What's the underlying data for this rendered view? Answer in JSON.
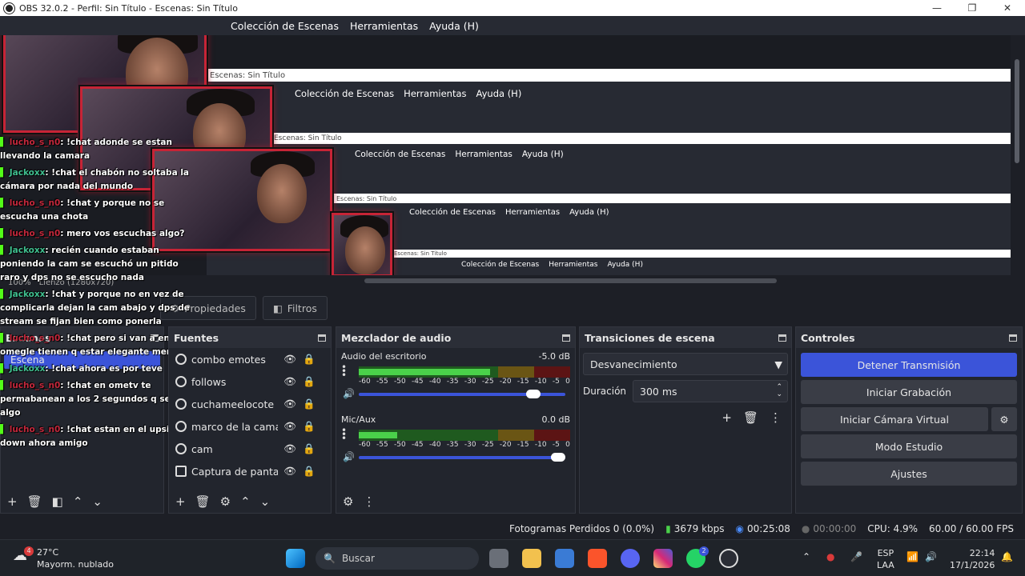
{
  "titlebar": {
    "title": "OBS 32.0.2 - Perfil: Sin Título - Escenas: Sin Título"
  },
  "menu": [
    "Colección de Escenas",
    "Herramientas",
    "Ayuda (H)"
  ],
  "nested": {
    "bar_label": "Escenas: Sin Título",
    "canvas_label": "Lienzo (1280x720)",
    "zoom": "100%"
  },
  "chat": [
    {
      "user": "lucho_s_n0",
      "text": ": !chat adonde se estan llevando la camara"
    },
    {
      "user": "Jackoxx",
      "text": ": !chat el chabón no soltaba la cámara por nada del mundo"
    },
    {
      "user": "lucho_s_n0",
      "text": ": !chat y porque no se escucha una chota"
    },
    {
      "user": "lucho_s_n0",
      "text": ": mero vos escuchas algo?"
    },
    {
      "user": "Jackoxx",
      "text": ": recién cuando estaban poniendo la cam se escuchó un pitido raro y dps no se escucho nada"
    },
    {
      "user": "Jackoxx",
      "text": ": !chat y porque no en vez de complicarla dejan la cam abajo y dps de stream se fijan bien como ponerla"
    },
    {
      "user": "lucho_s_n0",
      "text": ": !chat pero si van a entrar a omegle tienen q estar elegante mero"
    },
    {
      "user": "Jackoxx",
      "text": ": !chat ahora es por teve"
    },
    {
      "user": "lucho_s_n0",
      "text": ": !chat en ometv te permabanean a los 2 segundos q se ve algo"
    },
    {
      "user": "lucho_s_n0",
      "text": ": !chat estan en el upside down ahora amigo"
    }
  ],
  "tabs": {
    "properties": "Propiedades",
    "filters": "Filtros"
  },
  "scenes": {
    "title": "Escenas",
    "items": [
      "Escena"
    ]
  },
  "sources": {
    "title": "Fuentes",
    "items": [
      "combo emotes",
      "follows",
      "cuchameelocote",
      "marco de la camara",
      "cam",
      "Captura de pantalla"
    ]
  },
  "mixer": {
    "title": "Mezclador de audio",
    "channels": [
      {
        "name": "Audio del escritorio",
        "db": "-5.0 dB",
        "level": 0.62,
        "volume": 0.88
      },
      {
        "name": "Mic/Aux",
        "db": "0.0 dB",
        "level": 0.18,
        "volume": 1.0
      }
    ],
    "ticks": [
      "-60",
      "-55",
      "-50",
      "-45",
      "-40",
      "-35",
      "-30",
      "-25",
      "-20",
      "-15",
      "-10",
      "-5",
      "0"
    ]
  },
  "transitions": {
    "title": "Transiciones de escena",
    "selected": "Desvanecimiento",
    "duration_label": "Duración",
    "duration": "300 ms"
  },
  "controls": {
    "title": "Controles",
    "stop_stream": "Detener Transmisión",
    "record": "Iniciar Grabación",
    "virtual_cam": "Iniciar Cámara Virtual",
    "studio": "Modo Estudio",
    "settings": "Ajustes"
  },
  "status": {
    "dropped": "Fotogramas Perdidos 0 (0.0%)",
    "bitrate": "3679 kbps",
    "stream_time": "00:25:08",
    "rec_time": "00:00:00",
    "cpu": "CPU: 4.9%",
    "fps": "60.00 / 60.00 FPS"
  },
  "taskbar": {
    "temp": "27°C",
    "weather": "Mayorm. nublado",
    "weather_badge": "4",
    "search": "Buscar",
    "lang1": "ESP",
    "lang2": "LAA",
    "time": "22:14",
    "date": "17/1/2026",
    "discord_badge": "2"
  },
  "colors": {
    "accent": "#3b54d9",
    "panel": "#22252d"
  }
}
